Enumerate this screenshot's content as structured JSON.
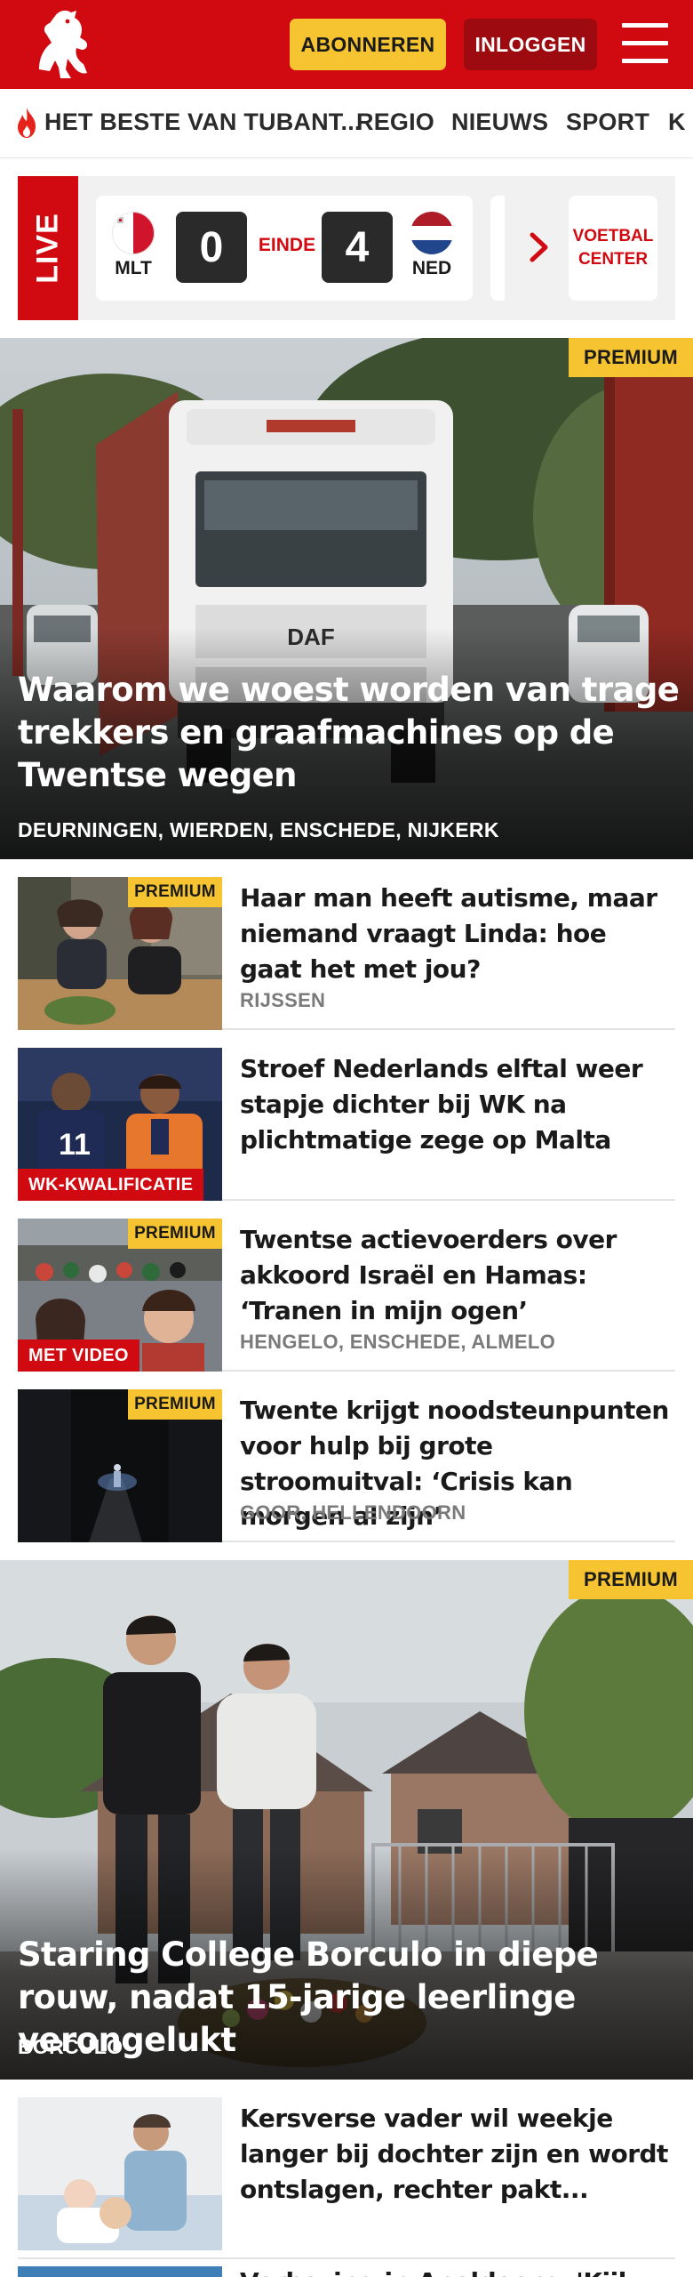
{
  "header": {
    "subscribe_label": "ABONNEREN",
    "login_label": "INLOGGEN",
    "brand_color": "#d10a11",
    "accent_color": "#f6c431"
  },
  "nav": {
    "items": [
      "HET BESTE VAN TUBANT...",
      "REGIO",
      "NIEUWS",
      "SPORT",
      "K"
    ]
  },
  "live": {
    "label": "LIVE",
    "home_code": "MLT",
    "home_score": "0",
    "status": "EINDE",
    "away_score": "4",
    "away_code": "NED",
    "center_line1": "VOETBAL",
    "center_line2": "CENTER"
  },
  "hero1": {
    "badge": "PREMIUM",
    "title": "Waarom we woest worden van trage trekkers en graafmachines op de Twentse wegen",
    "location": "DEURNINGEN, WIERDEN, ENSCHEDE, NIJKERK"
  },
  "articles": [
    {
      "badge": "PREMIUM",
      "tag": "",
      "title": "Haar man heeft autisme, maar niemand vraagt Linda: hoe gaat het met jou?",
      "location": "RIJSSEN"
    },
    {
      "badge": "",
      "tag": "WK-KWALIFICATIE",
      "title": "Stroef Nederlands elftal weer stapje dichter bij WK na plichtmatige zege op Malta",
      "location": ""
    },
    {
      "badge": "PREMIUM",
      "tag": "MET VIDEO",
      "title": "Twentse actievoerders over akkoord Israël en Hamas: ‘Tranen in mijn ogen’",
      "location": "HENGELO, ENSCHEDE, ALMELO"
    },
    {
      "badge": "PREMIUM",
      "tag": "",
      "title": "Twente krijgt noodsteunpunten voor hulp bij grote stroomuitval: ‘Crisis kan morgen al zijn’",
      "location": "GOOR, HELLENDOORN"
    }
  ],
  "hero2": {
    "badge": "PREMIUM",
    "title": "Staring College Borculo in diepe rouw, nadat 15-jarige leerlinge verongelukt",
    "location": "BORCULO"
  },
  "article_after": {
    "title": "Kersverse vader wil weekje langer bij dochter zijn en wordt ontslagen, rechter pakt..."
  },
  "article_cut": {
    "title": "Verbazing in Apeldoorn: 'Kijk die ...'"
  }
}
